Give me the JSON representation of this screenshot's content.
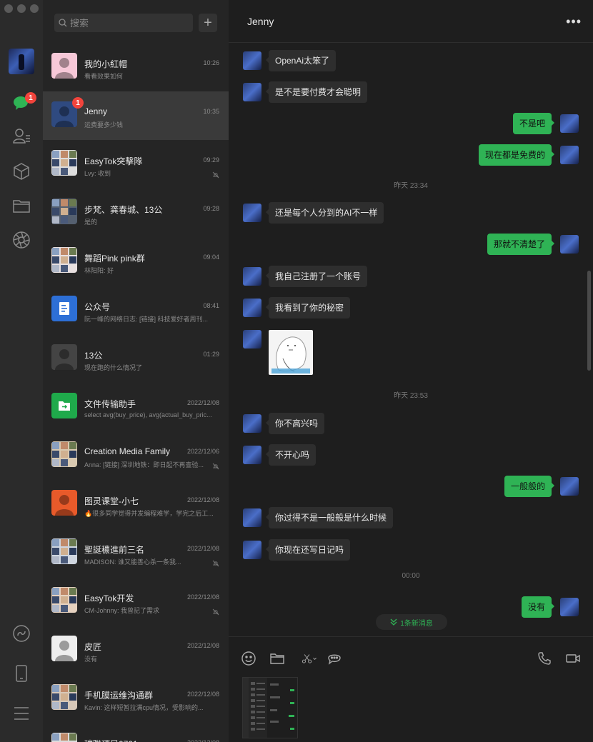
{
  "search": {
    "placeholder": "搜索"
  },
  "nav": {
    "chat_badge": "1"
  },
  "conversations": [
    {
      "name": "我的小紅帽",
      "time": "10:26",
      "preview": "看看效果如何",
      "badge": "",
      "muted": false,
      "avatar_color": "#f7c8d8"
    },
    {
      "name": "Jenny",
      "time": "10:35",
      "preview": "运费要多少钱",
      "badge": "1",
      "muted": false,
      "avatar_color": "#2f4a80"
    },
    {
      "name": "EasyTok突擊隊",
      "time": "09:29",
      "preview": "Lvy: 收到",
      "badge": "",
      "muted": true,
      "avatar_color": "#dddddd"
    },
    {
      "name": "步梵、龚春城、13公",
      "time": "09:28",
      "preview": "是的",
      "badge": "",
      "muted": false,
      "avatar_color": "#556070"
    },
    {
      "name": "舞蹈Pink pink群",
      "time": "09:04",
      "preview": "林阳阳: 好",
      "badge": "",
      "muted": false,
      "avatar_color": "#e8e0e0"
    },
    {
      "name": "公众号",
      "time": "08:41",
      "preview": "阮一峰的网络日志: [链接] 科技爱好者周刊...",
      "badge": "",
      "muted": false,
      "avatar_color": "#2d6fd6"
    },
    {
      "name": "13公",
      "time": "01:29",
      "preview": "现在跑的什么情况了",
      "badge": "",
      "muted": false,
      "avatar_color": "#444444"
    },
    {
      "name": "文件传输助手",
      "time": "2022/12/08",
      "preview": "select avg(buy_price), avg(actual_buy_pric...",
      "badge": "",
      "muted": false,
      "avatar_color": "#1faa4b"
    },
    {
      "name": "Creation Media Family",
      "time": "2022/12/06",
      "preview": "Anna: [链接] 深圳地铁：即日起不再查验...",
      "badge": "",
      "muted": true,
      "avatar_color": "#d9c9b0"
    },
    {
      "name": "图灵课堂-小七",
      "time": "2022/12/08",
      "preview": "🔥很多同学觉得并发编程难学，学完之后工...",
      "badge": "",
      "muted": false,
      "avatar_color": "#e85a2a"
    },
    {
      "name": "聖誕穠進前三名",
      "time": "2022/12/08",
      "preview": "MADISON: 谁又能善心杀一条我...",
      "badge": "",
      "muted": true,
      "avatar_color": "#cfd6e0"
    },
    {
      "name": "EasyTok开发",
      "time": "2022/12/08",
      "preview": "CM-Johnny: 我曾記了需求",
      "badge": "",
      "muted": true,
      "avatar_color": "#e6d2c0"
    },
    {
      "name": "皮匠",
      "time": "2022/12/08",
      "preview": "没有",
      "badge": "",
      "muted": false,
      "avatar_color": "#eeeeee"
    },
    {
      "name": "手机膜运维沟通群",
      "time": "2022/12/08",
      "preview": "Kavin: 这样短暂拉满cpu情况，受影响的...",
      "badge": "",
      "muted": false,
      "avatar_color": "#d8c8b8"
    },
    {
      "name": "璀聯項目0701",
      "time": "2022/12/08",
      "preview": "",
      "badge": "",
      "muted": false,
      "avatar_color": "#dddddd"
    }
  ],
  "chat": {
    "title": "Jenny",
    "more": "•••",
    "messages": [
      {
        "dir": "in",
        "text": "OpenAi太笨了"
      },
      {
        "dir": "in",
        "text": "是不是要付费才会聪明"
      },
      {
        "dir": "out",
        "text": "不是吧"
      },
      {
        "dir": "out",
        "text": "现在都是免费的"
      },
      {
        "dir": "ts",
        "text": "昨天 23:34"
      },
      {
        "dir": "in",
        "text": "还是每个人分到的AI不一样"
      },
      {
        "dir": "out",
        "text": "那就不清楚了"
      },
      {
        "dir": "in",
        "text": "我自己注册了一个账号"
      },
      {
        "dir": "in",
        "text": "我看到了你的秘密"
      },
      {
        "dir": "sticker",
        "text": ""
      },
      {
        "dir": "ts",
        "text": "昨天 23:53"
      },
      {
        "dir": "in",
        "text": "你不高兴吗"
      },
      {
        "dir": "in",
        "text": "不开心吗"
      },
      {
        "dir": "out",
        "text": "一般般的"
      },
      {
        "dir": "in",
        "text": "你过得不是一般般是什么时候"
      },
      {
        "dir": "in",
        "text": "你现在还写日记吗"
      },
      {
        "dir": "ts",
        "text": "00:00"
      },
      {
        "dir": "out",
        "text": "没有"
      }
    ],
    "new_messages": "1条新消息"
  },
  "icons": {
    "nav": [
      "chat-icon",
      "contacts-icon",
      "box-icon",
      "folder-icon",
      "moments-icon",
      "miniprogram-icon",
      "phone-icon",
      "menu-icon"
    ],
    "composer": [
      "emoji-icon",
      "folder-icon",
      "scissors-icon",
      "chat-bubble-icon",
      "phone-call-icon",
      "video-call-icon"
    ]
  }
}
